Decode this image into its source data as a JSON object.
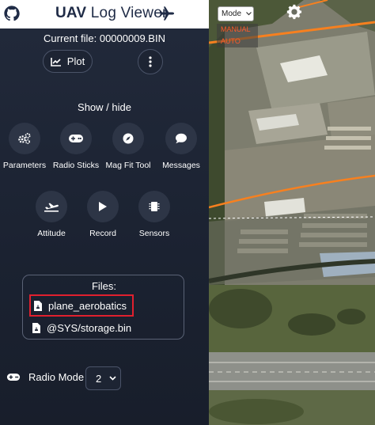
{
  "header": {
    "title_bold": "UAV",
    "title_rest": " Log Viewer"
  },
  "current_file": "Current file: 00000009.BIN",
  "actions": {
    "plot_label": "Plot"
  },
  "show_hide_label": "Show / hide",
  "tools": [
    {
      "label": "Parameters",
      "icon": "gears-icon"
    },
    {
      "label": "Radio Sticks",
      "icon": "gamepad-icon"
    },
    {
      "label": "Mag Fit Tool",
      "icon": "compass-icon"
    },
    {
      "label": "Messages",
      "icon": "chat-bubble-icon"
    },
    {
      "label": "Attitude",
      "icon": "plane-takeoff-icon"
    },
    {
      "label": "Record",
      "icon": "play-icon"
    },
    {
      "label": "Sensors",
      "icon": "chip-icon"
    }
  ],
  "files": {
    "title": "Files:",
    "items": [
      {
        "name": "plane_aerobatics",
        "selected": true
      },
      {
        "name": "@SYS/storage.bin",
        "selected": false
      }
    ]
  },
  "radio_mode": {
    "label": "Radio Mode",
    "value": "2"
  },
  "map": {
    "mode_select": "Mode",
    "mode_legend": [
      "MANUAL",
      "AUTO"
    ],
    "track_color": "#f7801f",
    "legend_color": "#ff5a2a"
  },
  "colors": {
    "accent_selected_border": "#e0202e",
    "sidebar_bg": "#1d2433"
  }
}
